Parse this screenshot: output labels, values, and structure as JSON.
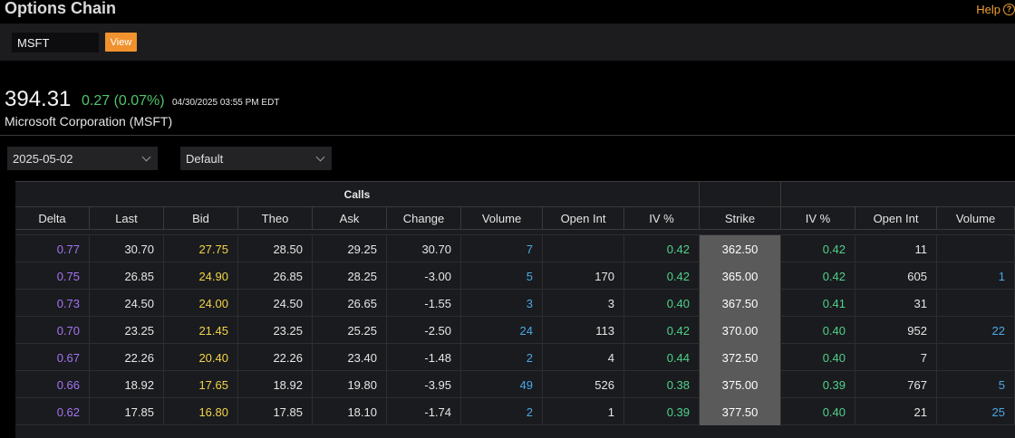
{
  "header": {
    "title": "Options Chain",
    "help_label": "Help",
    "help_icon": "?"
  },
  "search": {
    "value": "MSFT",
    "button_label": "View"
  },
  "quote": {
    "price": "394.31",
    "change": "0.27 (0.07%)",
    "timestamp": "04/30/2025 03:55 PM EDT",
    "company": "Microsoft Corporation (MSFT)"
  },
  "filters": {
    "expiration": "2025-05-02",
    "view": "Default"
  },
  "colors": {
    "delta": "#a374f2",
    "bid": "#f2d54a",
    "volume": "#4aa8e8",
    "iv": "#4fd18c",
    "accent": "#f0922d",
    "up": "#4fc36b"
  },
  "table": {
    "calls_label": "Calls",
    "headers": [
      "Delta",
      "Last",
      "Bid",
      "Theo",
      "Ask",
      "Change",
      "Volume",
      "Open Int",
      "IV %",
      "Strike",
      "IV %",
      "Open Int",
      "Volume"
    ],
    "rows": [
      {
        "delta": "0.77",
        "last": "30.70",
        "bid": "27.75",
        "theo": "28.50",
        "ask": "29.25",
        "change": "30.70",
        "volume": "7",
        "oi": "",
        "iv": "0.42",
        "strike": "362.50",
        "p_iv": "0.42",
        "p_oi": "11",
        "p_vol": ""
      },
      {
        "delta": "0.75",
        "last": "26.85",
        "bid": "24.90",
        "theo": "26.85",
        "ask": "28.25",
        "change": "-3.00",
        "volume": "5",
        "oi": "170",
        "iv": "0.42",
        "strike": "365.00",
        "p_iv": "0.42",
        "p_oi": "605",
        "p_vol": "1"
      },
      {
        "delta": "0.73",
        "last": "24.50",
        "bid": "24.00",
        "theo": "24.50",
        "ask": "26.65",
        "change": "-1.55",
        "volume": "3",
        "oi": "3",
        "iv": "0.40",
        "strike": "367.50",
        "p_iv": "0.41",
        "p_oi": "31",
        "p_vol": ""
      },
      {
        "delta": "0.70",
        "last": "23.25",
        "bid": "21.45",
        "theo": "23.25",
        "ask": "25.25",
        "change": "-2.50",
        "volume": "24",
        "oi": "113",
        "iv": "0.42",
        "strike": "370.00",
        "p_iv": "0.40",
        "p_oi": "952",
        "p_vol": "22"
      },
      {
        "delta": "0.67",
        "last": "22.26",
        "bid": "20.40",
        "theo": "22.26",
        "ask": "23.40",
        "change": "-1.48",
        "volume": "2",
        "oi": "4",
        "iv": "0.44",
        "strike": "372.50",
        "p_iv": "0.40",
        "p_oi": "7",
        "p_vol": ""
      },
      {
        "delta": "0.66",
        "last": "18.92",
        "bid": "17.65",
        "theo": "18.92",
        "ask": "19.80",
        "change": "-3.95",
        "volume": "49",
        "oi": "526",
        "iv": "0.38",
        "strike": "375.00",
        "p_iv": "0.39",
        "p_oi": "767",
        "p_vol": "5"
      },
      {
        "delta": "0.62",
        "last": "17.85",
        "bid": "16.80",
        "theo": "17.85",
        "ask": "18.10",
        "change": "-1.74",
        "volume": "2",
        "oi": "1",
        "iv": "0.39",
        "strike": "377.50",
        "p_iv": "0.40",
        "p_oi": "21",
        "p_vol": "25"
      }
    ]
  }
}
